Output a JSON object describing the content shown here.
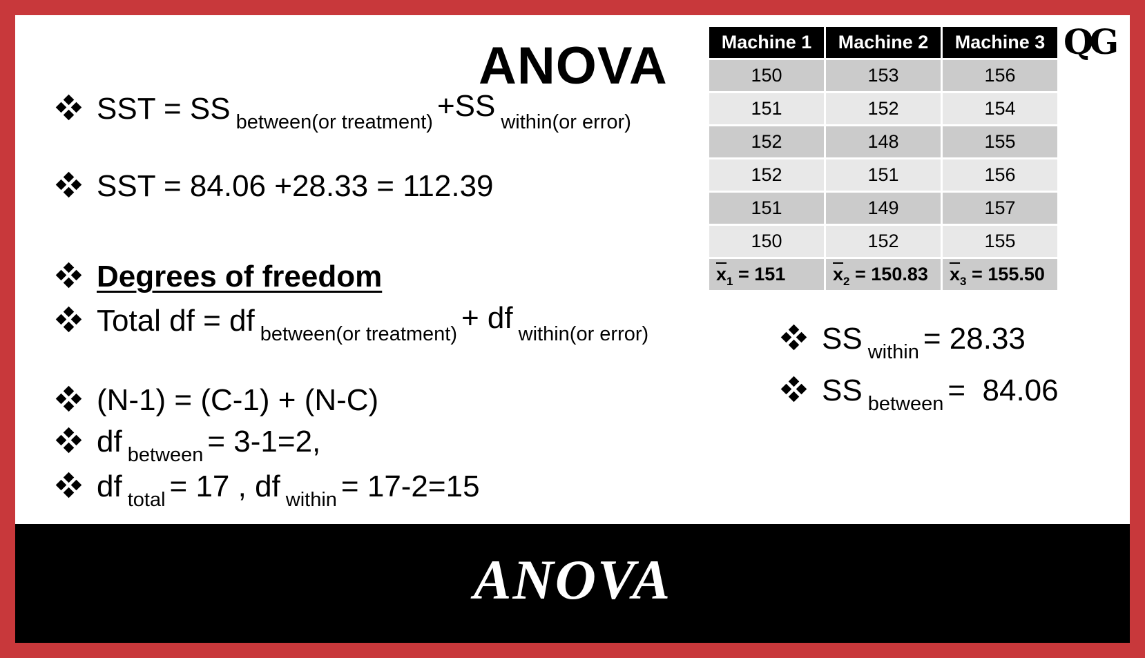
{
  "slide": {
    "title": "ANOVA",
    "logo": "QG",
    "colors": {
      "frame": "#c8383b",
      "banner": "#000000",
      "table_header": "#000000",
      "row_dark": "#cbcbcb",
      "row_light": "#e8e8e8"
    },
    "left_lines": [
      {
        "parts": [
          "SST = SS",
          "between(or treatment)",
          "+SS",
          "within(or error)"
        ]
      },
      {
        "text": "SST = 84.06 +28.33 = 112.39"
      },
      {
        "text": "Degrees of freedom"
      },
      {
        "parts": [
          "Total df = df",
          "between(or treatment)",
          "+ df",
          "within(or error)"
        ]
      },
      {
        "text": "(N-1) = (C-1) + (N-C)"
      },
      {
        "parts": [
          "df",
          "between",
          "= 3-1=2,"
        ]
      },
      {
        "parts": [
          "df",
          "total",
          "= 17 , df",
          "within",
          "= 17-2=15"
        ]
      }
    ],
    "right_lines": [
      {
        "parts": [
          "SS",
          "within",
          "= 28.33"
        ]
      },
      {
        "parts": [
          "SS",
          "between",
          "=  84.06"
        ]
      }
    ],
    "table": {
      "headers": [
        "Machine 1",
        "Machine 2",
        "Machine 3"
      ],
      "rows": [
        [
          "150",
          "153",
          "156"
        ],
        [
          "151",
          "152",
          "154"
        ],
        [
          "152",
          "148",
          "155"
        ],
        [
          "152",
          "151",
          "156"
        ],
        [
          "151",
          "149",
          "157"
        ],
        [
          "150",
          "152",
          "155"
        ]
      ],
      "means": [
        {
          "symbol": "x",
          "index": "1",
          "value": "= 151"
        },
        {
          "symbol": "x",
          "index": "2",
          "value": "= 150.83"
        },
        {
          "symbol": "x",
          "index": "3",
          "value": "= 155.50"
        }
      ]
    },
    "banner_title": "ANOVA"
  }
}
